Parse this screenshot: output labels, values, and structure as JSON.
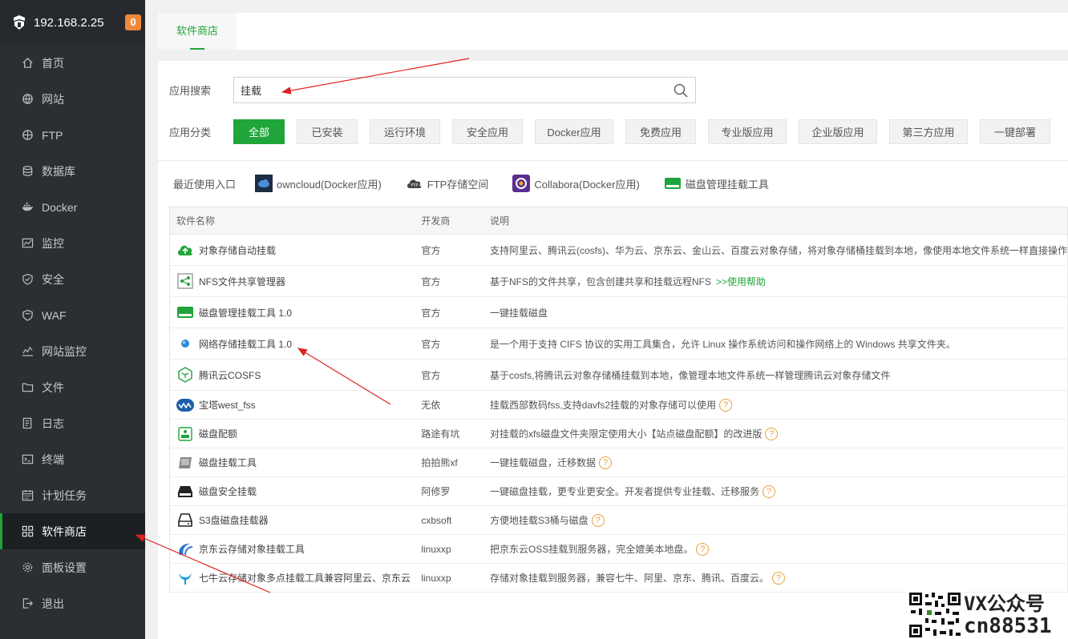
{
  "sidebar": {
    "host": "192.168.2.25",
    "badge": "0",
    "items": [
      {
        "label": "首页",
        "icon": "home-icon"
      },
      {
        "label": "网站",
        "icon": "globe-icon"
      },
      {
        "label": "FTP",
        "icon": "ftp-globe-icon"
      },
      {
        "label": "数据库",
        "icon": "database-icon"
      },
      {
        "label": "Docker",
        "icon": "docker-icon"
      },
      {
        "label": "监控",
        "icon": "monitor-icon"
      },
      {
        "label": "安全",
        "icon": "shield-check-icon"
      },
      {
        "label": "WAF",
        "icon": "waf-shield-icon"
      },
      {
        "label": "网站监控",
        "icon": "chart-line-icon"
      },
      {
        "label": "文件",
        "icon": "folder-icon"
      },
      {
        "label": "日志",
        "icon": "log-icon"
      },
      {
        "label": "终端",
        "icon": "terminal-icon"
      },
      {
        "label": "计划任务",
        "icon": "calendar-icon"
      },
      {
        "label": "软件商店",
        "icon": "grid-icon",
        "active": true
      },
      {
        "label": "面板设置",
        "icon": "gear-icon"
      },
      {
        "label": "退出",
        "icon": "logout-icon"
      }
    ]
  },
  "topbar": {
    "tab_label": "软件商店"
  },
  "search": {
    "label": "应用搜索",
    "value": "挂载"
  },
  "categories": {
    "label": "应用分类",
    "items": [
      "全部",
      "已安装",
      "运行环境",
      "安全应用",
      "Docker应用",
      "免费应用",
      "专业版应用",
      "企业版应用",
      "第三方应用",
      "一键部署"
    ]
  },
  "recent": {
    "label": "最近使用入口",
    "items": [
      "owncloud(Docker应用)",
      "FTP存储空间",
      "Collabora(Docker应用)",
      "磁盘管理挂载工具"
    ]
  },
  "table": {
    "headers": [
      "软件名称",
      "开发商",
      "说明"
    ],
    "rows": [
      {
        "name": "对象存储自动挂载",
        "dev": "官方",
        "desc": "支持阿里云、腾讯云(cosfs)、华为云、京东云、金山云、百度云对象存储，将对象存储桶挂载到本地，像使用本地文件系统一样直接操作",
        "icon": "cloud-upload-icon"
      },
      {
        "name": "NFS文件共享管理器",
        "dev": "官方",
        "desc": "基于NFS的文件共享，包含创建共享和挂载远程NFS",
        "help": ">>使用帮助",
        "icon": "share-icon"
      },
      {
        "name": "磁盘管理挂载工具 1.0",
        "dev": "官方",
        "desc": "一键挂载磁盘",
        "icon": "disk-icon"
      },
      {
        "name": "网络存储挂载工具 1.0",
        "dev": "官方",
        "desc": "是一个用于支持 CIFS 协议的实用工具集合，允许 Linux 操作系统访问和操作网络上的 Windows 共享文件夹。",
        "icon": "network-storage-icon"
      },
      {
        "name": "腾讯云COSFS",
        "dev": "官方",
        "desc": "基于cosfs,将腾讯云对象存储桶挂载到本地，像管理本地文件系统一样管理腾讯云对象存储文件",
        "icon": "cube-icon"
      },
      {
        "name": "宝塔west_fss",
        "dev": "无依",
        "desc": "挂载西部数码fss,支持davfs2挂载的对象存储可以使用",
        "icon": "wave-icon",
        "q": true
      },
      {
        "name": "磁盘配额",
        "dev": "路途有坑",
        "desc": "对挂载的xfs磁盘文件夹限定使用大小【站点磁盘配额】的改进版",
        "icon": "quota-icon",
        "q": true
      },
      {
        "name": "磁盘挂载工具",
        "dev": "拍拍熊xf",
        "desc": "一键挂载磁盘，迁移数据",
        "icon": "hdd-icon",
        "q": true
      },
      {
        "name": "磁盘安全挂载",
        "dev": "阿修罗",
        "desc": "一键磁盘挂载，更专业更安全。开发者提供专业挂载、迁移服务",
        "icon": "drive-icon",
        "q": true
      },
      {
        "name": "S3盘磁盘挂载器",
        "dev": "cxbsoft",
        "desc": "方便地挂载S3桶与磁盘",
        "icon": "s3-disk-icon",
        "q": true
      },
      {
        "name": "京东云存储对象挂载工具",
        "dev": "linuxxp",
        "desc": "把京东云OSS挂载到服务器，完全媲美本地盘。",
        "icon": "jd-cloud-icon",
        "q": true
      },
      {
        "name": "七牛云存储对象多点挂载工具兼容阿里云、京东云",
        "dev": "linuxxp",
        "desc": "存储对象挂载到服务器，兼容七牛、阿里、京东、腾讯、百度云。",
        "icon": "qiniu-icon",
        "q": true
      }
    ]
  },
  "watermark": {
    "line1": "VX公众号",
    "line2": "cn88531"
  }
}
